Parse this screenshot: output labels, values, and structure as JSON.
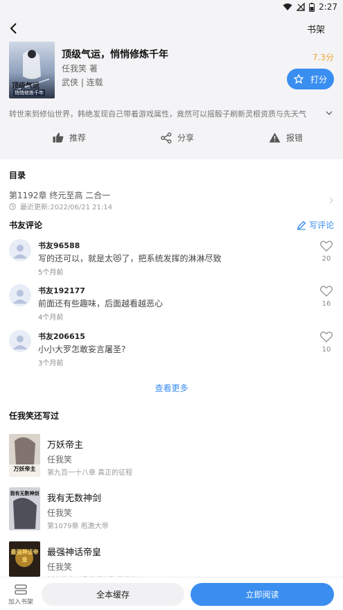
{
  "status_bar": {
    "time": "2:27",
    "icons": [
      "wifi-icon",
      "signal-icon",
      "battery-icon"
    ]
  },
  "header": {
    "back_icon": "back-arrow-icon",
    "shelf_label": "书架"
  },
  "book": {
    "title": "顶级气运，悄悄修炼千年",
    "cover_title": "顶级气运",
    "cover_subtitle": "悄悄修炼千年",
    "author": "任我笑 著",
    "tags": "武侠 | 连载",
    "score": "7.3分",
    "rate_label": "打分",
    "summary": "转世来到修仙世界，韩绝发现自己带着游戏属性，竟然可以摇骰子刷新灵根资质与先天气"
  },
  "actions": {
    "recommend": "推荐",
    "share": "分享",
    "report": "报错"
  },
  "toc": {
    "title": "目录",
    "latest_chapter": "第1192章 终元至高 二合一",
    "updated": "最近更新:2022/06/21 21:14"
  },
  "comments": {
    "title": "书友评论",
    "write_label": "写评论",
    "items": [
      {
        "name": "书友96588",
        "text": "写的还可以，就是太😻了，把系统发挥的淋淋尽致",
        "time": "5个月前",
        "likes": "20"
      },
      {
        "name": "书友192177",
        "text": "前面还有些趣味，后面越看越恶心",
        "time": "4个月前",
        "likes": "16"
      },
      {
        "name": "书友206615",
        "text": "小小大罗怎敢妄言屠圣?",
        "time": "3个月前",
        "likes": "10"
      }
    ],
    "see_more": "查看更多"
  },
  "author_books": {
    "title": "任我笑还写过",
    "items": [
      {
        "title": "万妖帝主",
        "author": "任我笑",
        "latest": "第九百一十八章 真正的征程",
        "cover_text": "万妖帝主"
      },
      {
        "title": "我有无数神剑",
        "author": "任我笑",
        "latest": "第1079章 庖澹大帝",
        "cover_text": "我有无数神剑"
      },
      {
        "title": "最强神话帝皇",
        "author": "任我笑",
        "latest": "新书发布《我能看到隐藏机缘》",
        "cover_text": "最强神话帝皇"
      }
    ]
  },
  "bottom_bar": {
    "add_shelf": "加入书架",
    "cache_all": "全本缓存",
    "read_now": "立即阅读"
  },
  "colors": {
    "accent": "#3a8ef0",
    "score": "#f0a532",
    "header_bg": "#f4f4f6"
  }
}
